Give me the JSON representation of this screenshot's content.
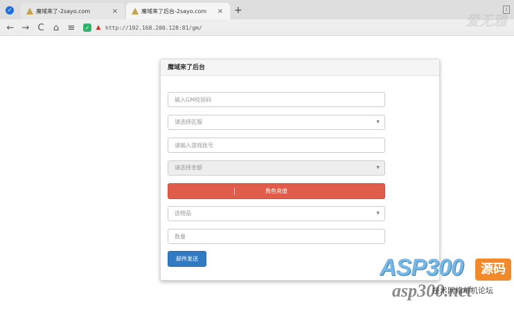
{
  "browser": {
    "tabs": [
      {
        "title": "魔域来了-2sayo.com",
        "active": false
      },
      {
        "title": "魔域来了后台-2sayo.com",
        "active": true
      }
    ],
    "close_glyph": "×",
    "new_tab_glyph": "+",
    "url": "http://192.168.200.128:81/gm/",
    "nav": {
      "back": "←",
      "forward": "→",
      "reload": "C",
      "home": "⌂",
      "reader": "≡"
    }
  },
  "panel": {
    "title": "魔域来了后台",
    "gm_code_placeholder": "输入GM校验码",
    "server_select": "请选择区服",
    "account_placeholder": "请输入游戏账号",
    "amount_select": "请选择金额",
    "recharge_button": "角色充值",
    "item_select": "选物品",
    "quantity_placeholder": "数量",
    "send_mail_button": "邮件发送"
  },
  "watermark": {
    "top": "爱无雅",
    "asp": "ASP300",
    "badge": "源码",
    "domain": "asp300.net",
    "subtitle": "技术网络单机论坛"
  },
  "colors": {
    "danger": "#e05d4b",
    "primary": "#2f7ac0"
  }
}
